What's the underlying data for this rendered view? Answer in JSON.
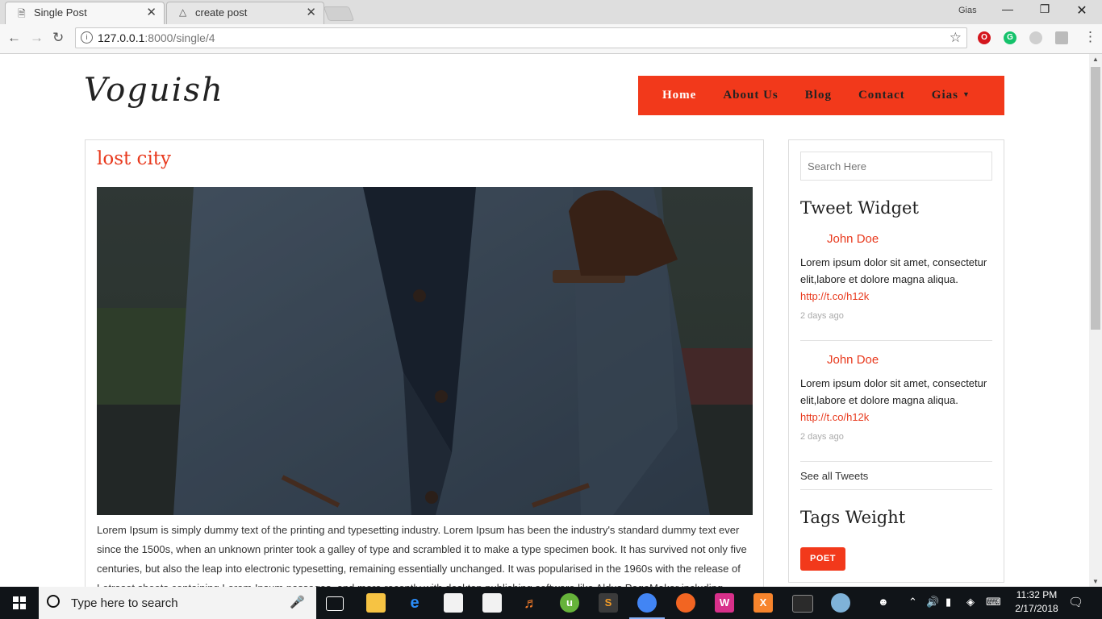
{
  "browser": {
    "tabs": [
      {
        "title": "Single Post",
        "icon": "document-icon",
        "active": true
      },
      {
        "title": "create post",
        "icon": "laravel-icon",
        "active": false
      }
    ],
    "profile_name": "Gias",
    "url_host": "127.0.0.1",
    "url_path": ":8000/single/4"
  },
  "site": {
    "logo": "Voguish",
    "nav": [
      {
        "label": "Home",
        "active": true
      },
      {
        "label": "About Us"
      },
      {
        "label": "Blog"
      },
      {
        "label": "Contact"
      },
      {
        "label": "Gias",
        "dropdown": true
      }
    ]
  },
  "post": {
    "title": "lost city",
    "image_description": "man in blue tweed blazer with brown glove in breast pocket",
    "body": "Lorem Ipsum is simply dummy text of the printing and typesetting industry. Lorem Ipsum has been the industry's standard dummy text ever since the 1500s, when an unknown printer took a galley of type and scrambled it to make a type specimen book. It has survived not only five centuries, but also the leap into electronic typesetting, remaining essentially unchanged. It was popularised in the 1960s with the release of Letraset sheets containing Lorem Ipsum passages, and more recently with desktop publishing software like Aldus PageMaker including versions of Lorem Ipsum."
  },
  "sidebar": {
    "search_placeholder": "Search Here",
    "tweet_widget_title": "Tweet Widget",
    "tweets": [
      {
        "author": "John Doe",
        "text": "Lorem ipsum dolor sit amet, consectetur elit,labore et dolore magna aliqua.",
        "link": "http://t.co/h12k",
        "time": "2 days ago"
      },
      {
        "author": "John Doe",
        "text": "Lorem ipsum dolor sit amet, consectetur elit,labore et dolore magna aliqua.",
        "link": "http://t.co/h12k",
        "time": "2 days ago"
      }
    ],
    "see_all": "See all Tweets",
    "tags_title": "Tags Weight",
    "tags": [
      "POET"
    ]
  },
  "taskbar": {
    "search_text": "Type here to search",
    "time": "11:32 PM",
    "date": "2/17/2018"
  },
  "colors": {
    "accent": "#f2391b",
    "link": "#e8391d"
  }
}
